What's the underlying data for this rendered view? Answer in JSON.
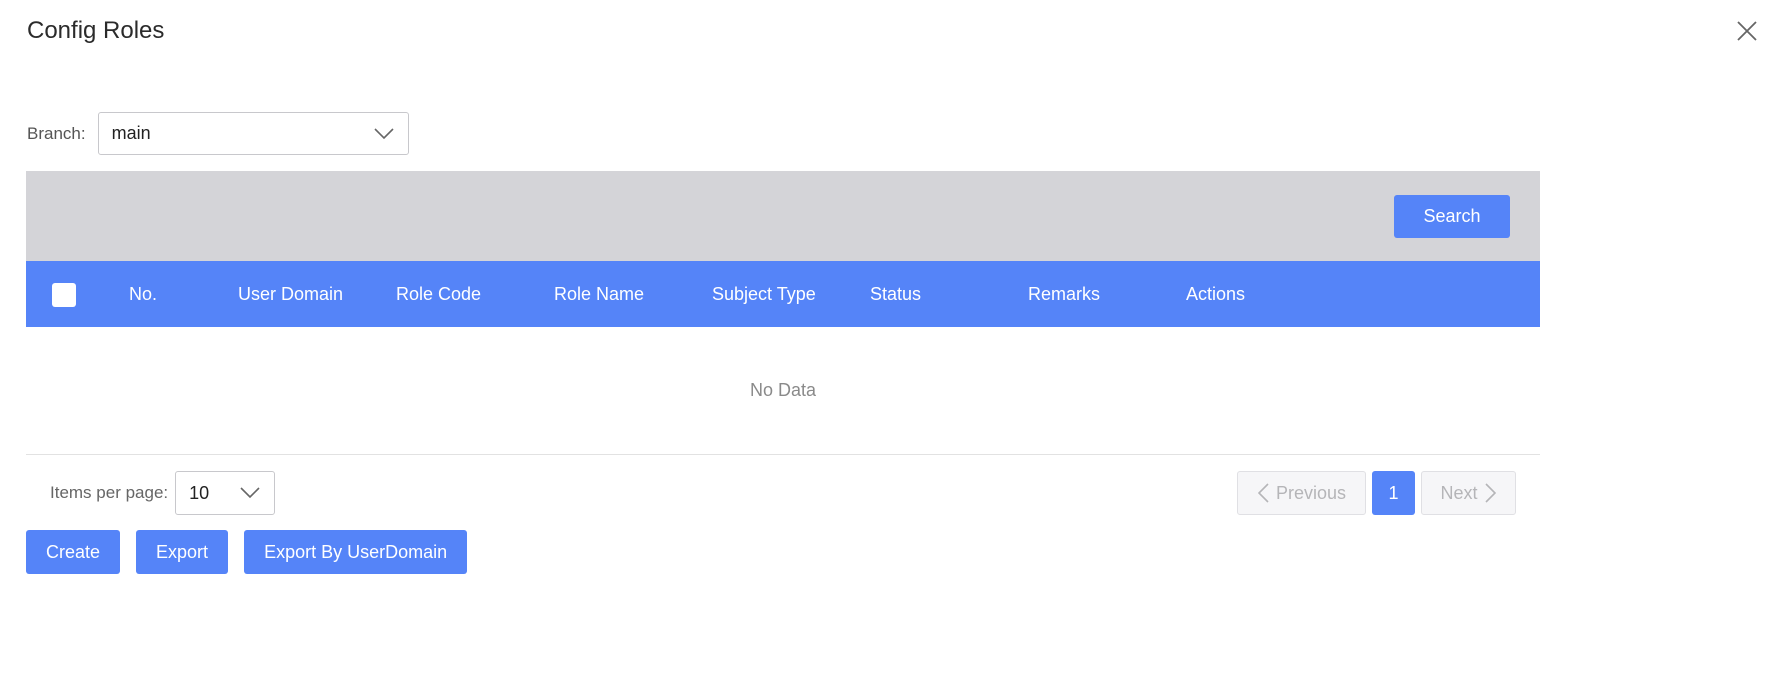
{
  "dialog": {
    "title": "Config Roles"
  },
  "branch": {
    "label": "Branch:",
    "value": "main"
  },
  "search": {
    "button_label": "Search"
  },
  "table": {
    "columns": [
      "No.",
      "User Domain",
      "Role Code",
      "Role Name",
      "Subject Type",
      "Status",
      "Remarks",
      "Actions"
    ],
    "empty_text": "No Data"
  },
  "pagination": {
    "items_per_page_label": "Items per page:",
    "page_size": "10",
    "previous_label": "Previous",
    "current_page": "1",
    "next_label": "Next"
  },
  "actions": {
    "create_label": "Create",
    "export_label": "Export",
    "export_by_domain_label": "Export By UserDomain"
  },
  "colors": {
    "accent": "#5584f8",
    "search_bar_bg": "#d4d4d8"
  },
  "icons": {
    "close": "close-icon",
    "dropdown": "chevron-down-icon",
    "prev": "chevron-left-icon",
    "next": "chevron-right-icon"
  }
}
